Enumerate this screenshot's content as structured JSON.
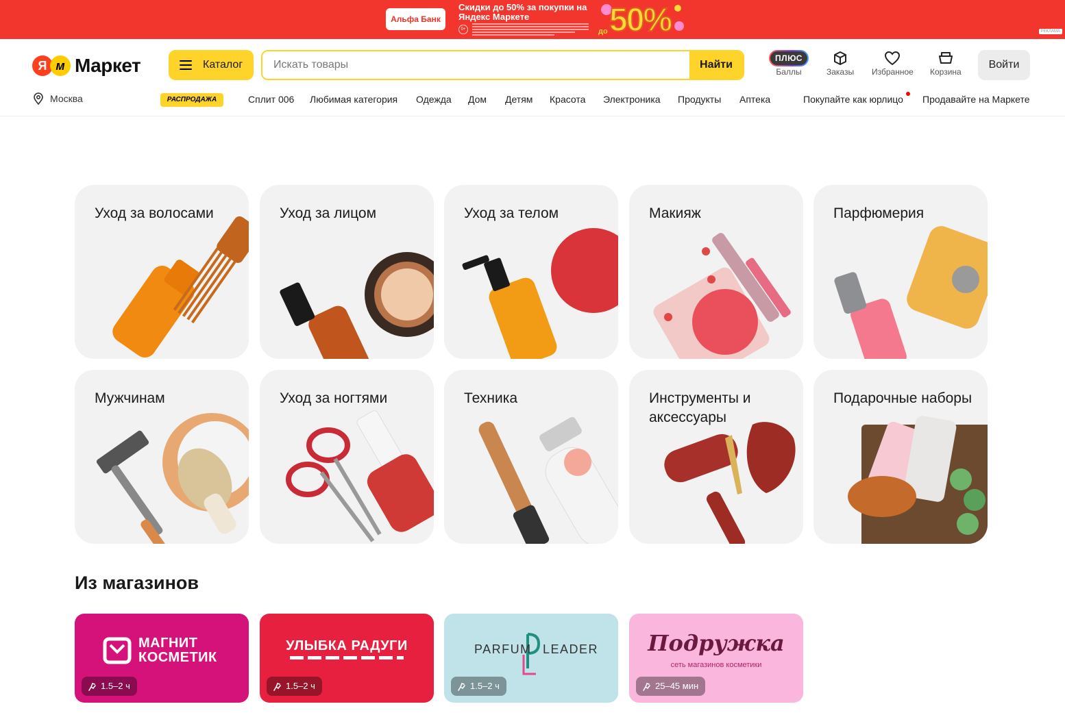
{
  "ad": {
    "brand": "Альфа Банк",
    "headline": "Скидки до 50% за покупки на Яндекс Маркете",
    "age": "0+",
    "sale_prefix": "до",
    "sale_value": "50%",
    "label": "РЕКЛАМА"
  },
  "header": {
    "logo_ya": "Я",
    "logo_m": "м",
    "logo_text": "Маркет",
    "catalog_label": "Каталог",
    "search_placeholder": "Искать товары",
    "search_button": "Найти",
    "plus_label": "ПЛЮС",
    "points_label": "Баллы",
    "orders_label": "Заказы",
    "favorites_label": "Избранное",
    "cart_label": "Корзина",
    "login_label": "Войти"
  },
  "subnav": {
    "city": "Москва",
    "sale_badge": "РАСПРОДАЖА",
    "items": [
      "Сплит 006",
      "Любимая категория",
      "Одежда",
      "Дом",
      "Детям",
      "Красота",
      "Электроника",
      "Продукты",
      "Аптека"
    ],
    "business": "Покупайте как юрлицо",
    "sell": "Продавайте на Маркете"
  },
  "categories": [
    {
      "title": "Уход за волосами",
      "icon": "hair-care-icon"
    },
    {
      "title": "Уход за лицом",
      "icon": "face-care-icon"
    },
    {
      "title": "Уход за телом",
      "icon": "body-care-icon"
    },
    {
      "title": "Макияж",
      "icon": "makeup-icon"
    },
    {
      "title": "Парфюмерия",
      "icon": "perfume-icon"
    },
    {
      "title": "Мужчинам",
      "icon": "men-icon"
    },
    {
      "title": "Уход за ногтями",
      "icon": "nail-care-icon"
    },
    {
      "title": "Техника",
      "icon": "appliances-icon"
    },
    {
      "title": "Инструменты и аксессуары",
      "icon": "tools-icon"
    },
    {
      "title": "Подарочные наборы",
      "icon": "gift-sets-icon"
    }
  ],
  "shops_title": "Из магазинов",
  "shops": [
    {
      "line1": "МАГНИТ",
      "line2": "КОСМЕТИК",
      "delivery": "1.5–2 ч",
      "color": "#d4127a"
    },
    {
      "line1": "УЛЫБКА РАДУГИ",
      "delivery": "1.5–2 ч",
      "color": "#e8203f"
    },
    {
      "line1": "PARFUM",
      "line2": "LEADER",
      "delivery": "1.5–2 ч",
      "color": "#bfe3e9"
    },
    {
      "line1": "Подружка",
      "line2": "сеть магазинов косметики",
      "delivery": "25–45 мин",
      "color": "#fbb6de"
    }
  ]
}
